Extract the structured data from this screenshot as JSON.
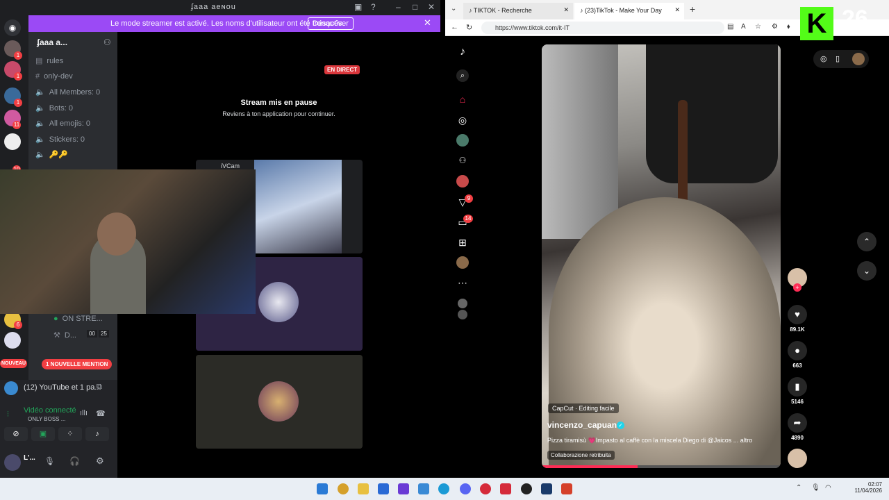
{
  "discord": {
    "title": "ʄaaa aeɴou",
    "banner": {
      "message": "Le mode streamer est activé. Les noms d'utilisateur ont été tronqués.",
      "button": "Désactiver"
    },
    "server_name": "ʄaaa a...",
    "channels": [
      "rules",
      "only-dev",
      "All Members: 0",
      "Bots: 0",
      "All emojis: 0",
      "Stickers: 0",
      "🔑🔑"
    ],
    "lower_channels": [
      "ON STRE...",
      "D..."
    ],
    "lower_count_left": "00",
    "lower_count_right": "25",
    "guild_badges": [
      "1",
      "1",
      "1",
      "11",
      "10",
      "6"
    ],
    "new_mention": "1 NOUVELLE MENTION",
    "new_label": "NOUVEAU",
    "stream": {
      "live": "EN DIRECT",
      "paused_title": "Stream mis en pause",
      "paused_sub": "Reviens à ton application pour continuer.",
      "cam_label": "iVCam"
    },
    "voice": {
      "now_playing": "(12) YouTube et 1 pa...",
      "status": "Vidéo connecté",
      "channel": "ONLY BOSS ...",
      "user": "L'..."
    }
  },
  "browser": {
    "tabs": [
      "TIKTOK - Recherche",
      "(23)TikTok - Make Your Day"
    ],
    "url": "https://www.tiktok.com/it-IT",
    "video": {
      "capcut": "CapCut · Editing facile",
      "author": "vincenzo_capuano",
      "caption": "Pizza tiramisù 💗Impasto al caffè con la miscela Diego di @Jaicos ... altro",
      "collab": "Collaborazione retribuita",
      "progress": 0.4
    },
    "actions": {
      "likes": "89.1K",
      "comments": "663",
      "saves": "5146",
      "shares": "4890"
    },
    "sidebar_badges": {
      "inbox": "9",
      "messages": "14"
    },
    "kick_count": "26",
    "kick_letter": "K"
  },
  "taskbar": {
    "time": "02:07",
    "date": "11/04/2026"
  }
}
